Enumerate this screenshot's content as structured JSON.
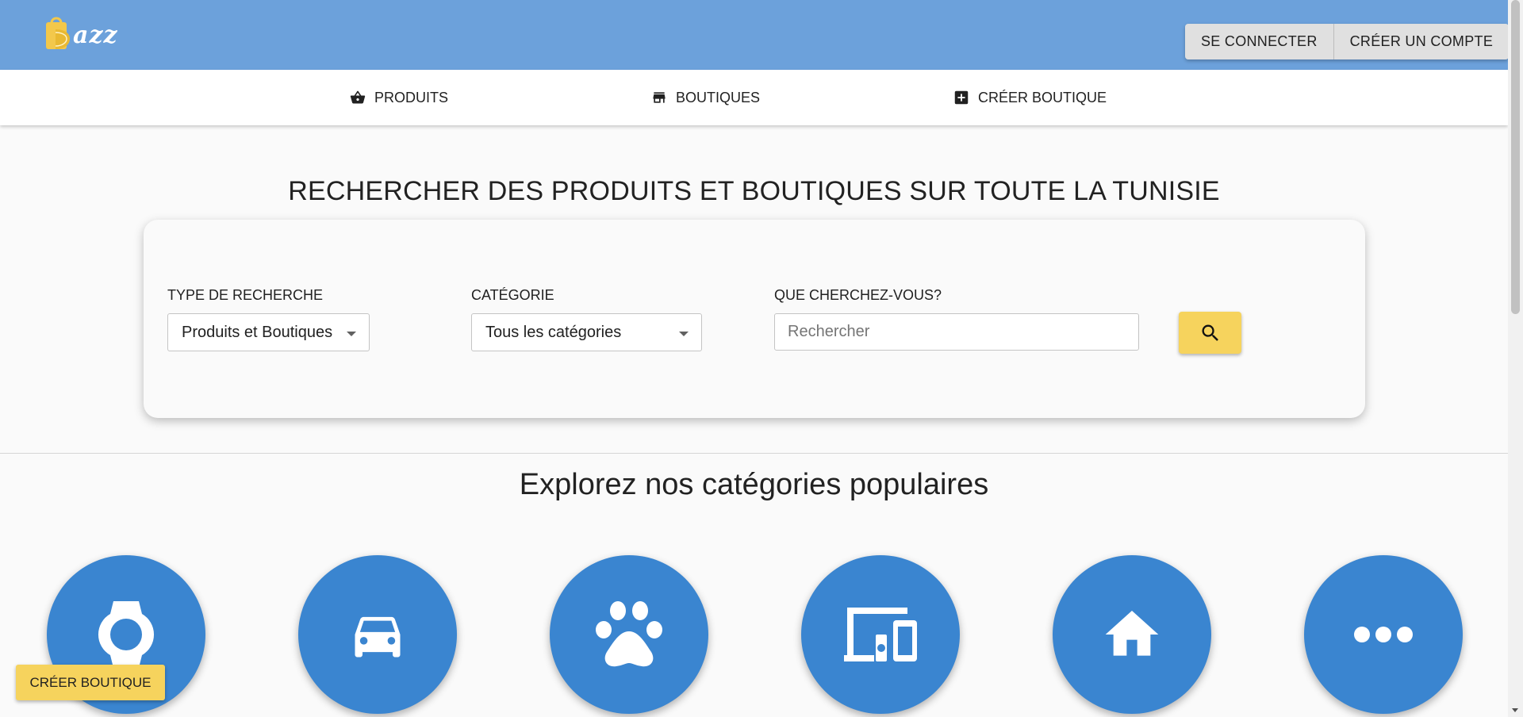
{
  "header": {
    "logo_text": "azz",
    "login_label": "SE CONNECTER",
    "register_label": "CRÉER UN COMPTE"
  },
  "nav": {
    "items": [
      {
        "label": "PRODUITS",
        "icon": "basket-icon"
      },
      {
        "label": "BOUTIQUES",
        "icon": "store-icon"
      },
      {
        "label": "CRÉER BOUTIQUE",
        "icon": "add-box-icon"
      }
    ]
  },
  "hero": {
    "title": "RECHERCHER DES PRODUITS ET BOUTIQUES SUR TOUTE LA TUNISIE"
  },
  "search": {
    "type_label": "TYPE DE RECHERCHE",
    "type_value": "Produits et Boutiques",
    "category_label": "CATÉGORIE",
    "category_value": "Tous les catégories",
    "query_label": "QUE CHERCHEZ-VOUS?",
    "query_placeholder": "Rechercher",
    "query_value": ""
  },
  "categories": {
    "title": "Explorez nos catégories populaires",
    "items": [
      {
        "icon": "watch-icon"
      },
      {
        "icon": "car-icon"
      },
      {
        "icon": "pet-paw-icon"
      },
      {
        "icon": "devices-icon"
      },
      {
        "icon": "home-icon"
      },
      {
        "icon": "more-icon"
      }
    ]
  },
  "floating": {
    "create_shop_label": "CRÉER BOUTIQUE"
  },
  "colors": {
    "header_bg": "#6ca1db",
    "accent_yellow": "#f6d35d",
    "category_blue": "#3a85d0"
  }
}
